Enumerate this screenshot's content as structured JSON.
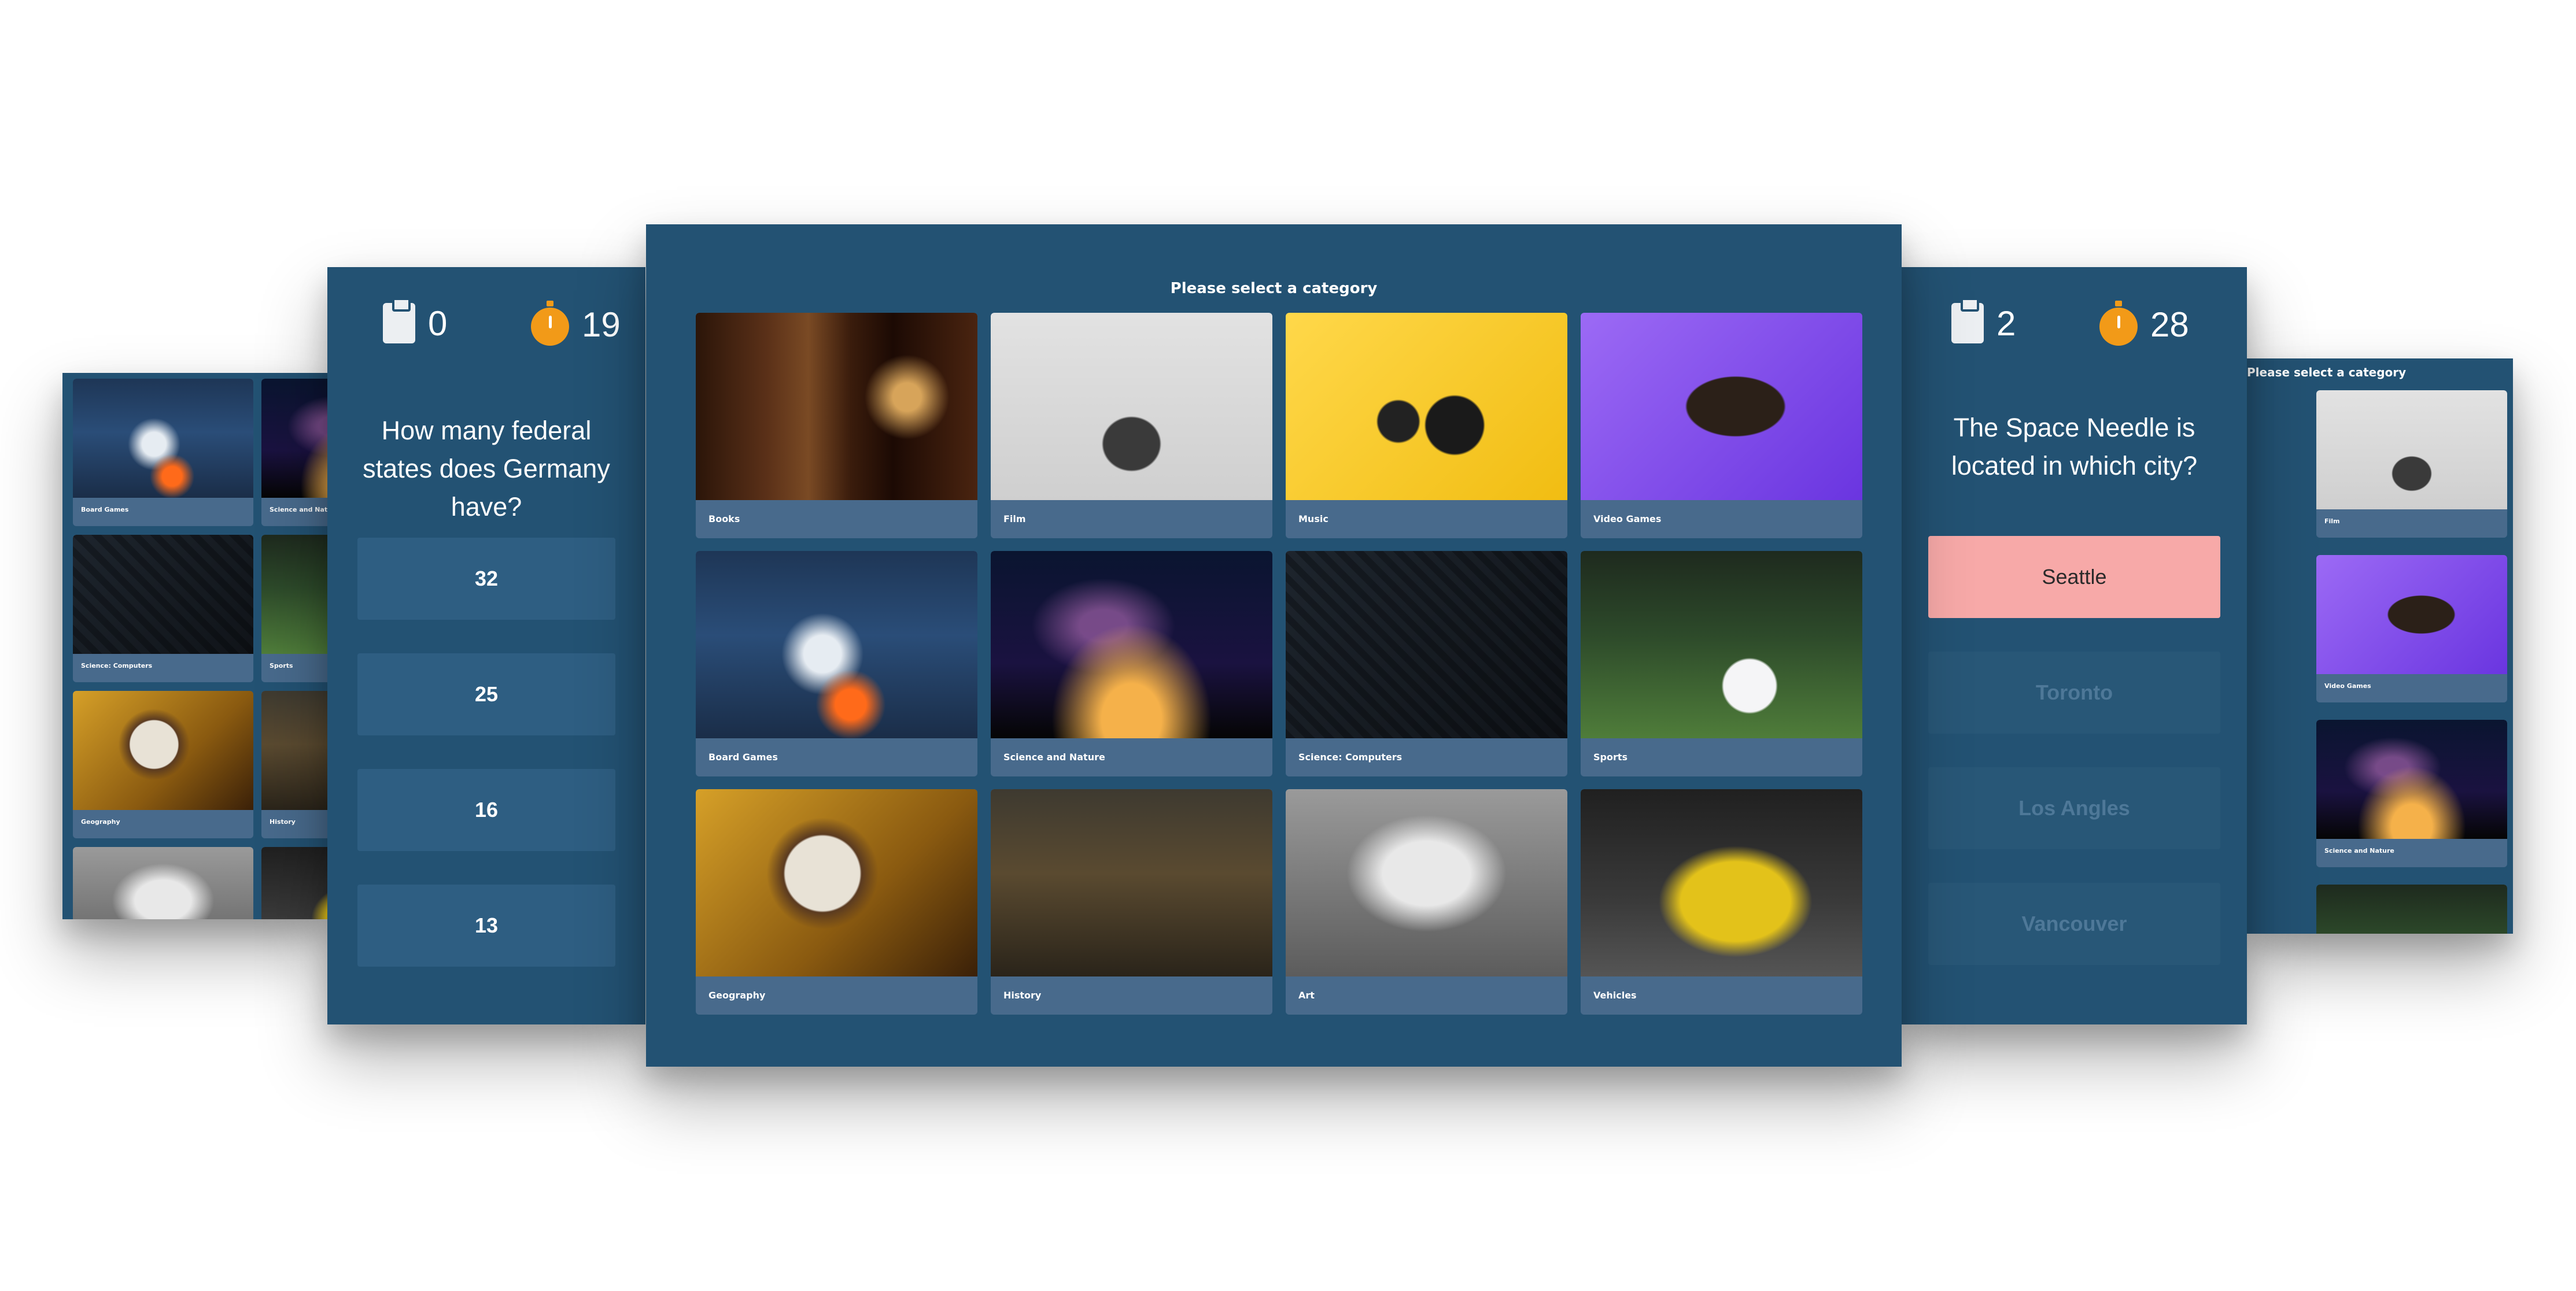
{
  "category_screen": {
    "title": "Please select a category",
    "categories": [
      {
        "label": "Books",
        "image": "bookshelf"
      },
      {
        "label": "Film",
        "image": "clapperboard"
      },
      {
        "label": "Music",
        "image": "headphones"
      },
      {
        "label": "Video Games",
        "image": "gamepad"
      },
      {
        "label": "Board Games",
        "image": "chess"
      },
      {
        "label": "Science and Nature",
        "image": "milky-way"
      },
      {
        "label": "Science: Computers",
        "image": "circuit-board"
      },
      {
        "label": "Sports",
        "image": "football"
      },
      {
        "label": "Geography",
        "image": "globe"
      },
      {
        "label": "History",
        "image": "painting"
      },
      {
        "label": "Art",
        "image": "statue"
      },
      {
        "label": "Vehicles",
        "image": "car"
      }
    ]
  },
  "quiz_left": {
    "score": "0",
    "timer": "19",
    "question": "How many federal states does Germany have?",
    "answers": [
      "32",
      "25",
      "16",
      "13"
    ]
  },
  "quiz_right": {
    "score": "2",
    "timer": "28",
    "question": "The Space Needle is located in which city?",
    "answers": [
      "Seattle",
      "Toronto",
      "Los Angles",
      "Vancouver"
    ],
    "selected": "Seattle"
  },
  "colors": {
    "panel": "#235273",
    "tile": "#486a8c",
    "answer": "#2e5e82",
    "selected_answer": "#f7a9a8",
    "timer_icon": "#f29a18"
  },
  "icons": {
    "score": "clipboard-icon",
    "timer": "stopwatch-icon"
  }
}
